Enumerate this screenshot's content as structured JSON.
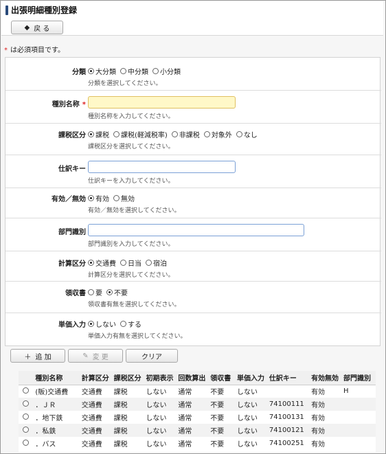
{
  "page": {
    "title": "出張明細種別登録",
    "back_label": "戻 る",
    "required_note": "は必須項目です。"
  },
  "form": {
    "category": {
      "label": "分類",
      "options": [
        "大分類",
        "中分類",
        "小分類"
      ],
      "selected": 0,
      "help": "分類を選択してください。"
    },
    "type_name": {
      "label": "種別名称",
      "value": "",
      "help": "種別名称を入力してください。"
    },
    "tax_category": {
      "label": "課税区分",
      "options": [
        "課税",
        "課税(軽減税率)",
        "非課税",
        "対象外",
        "なし"
      ],
      "selected": 0,
      "help": "課税区分を選択してください。"
    },
    "journal_key": {
      "label": "仕訳キー",
      "value": "",
      "help": "仕訳キーを入力してください。"
    },
    "enabled": {
      "label": "有効／無効",
      "options": [
        "有効",
        "無効"
      ],
      "selected": 0,
      "help": "有効／無効を選択してください。"
    },
    "dept_id": {
      "label": "部門識別",
      "value": "",
      "help": "部門識別を入力してください。"
    },
    "calc_category": {
      "label": "計算区分",
      "options": [
        "交通費",
        "日当",
        "宿泊"
      ],
      "selected": 0,
      "help": "計算区分を選択してください。"
    },
    "receipt": {
      "label": "領収書",
      "options": [
        "要",
        "不要"
      ],
      "selected": 1,
      "help": "領収書有無を選択してください。"
    },
    "unit_price": {
      "label": "単価入力",
      "options": [
        "しない",
        "する"
      ],
      "selected": 0,
      "help": "単価入力有無を選択してください。"
    }
  },
  "actions": {
    "add_label": "追 加",
    "edit_label": "変 更",
    "clear_label": "クリア"
  },
  "table": {
    "headers": [
      "種別名称",
      "計算区分",
      "課税区分",
      "初期表示",
      "回数算出",
      "領収書",
      "単価入力",
      "仕訳キー",
      "有効無効",
      "部門識別"
    ],
    "rows": [
      [
        "(販)交通費",
        "交通費",
        "課税",
        "しない",
        "通常",
        "不要",
        "しない",
        "",
        "有効",
        "H"
      ],
      [
        "．ＪＲ",
        "交通費",
        "課税",
        "しない",
        "通常",
        "不要",
        "しない",
        "74100111",
        "有効",
        ""
      ],
      [
        "．地下鉄",
        "交通費",
        "課税",
        "しない",
        "通常",
        "不要",
        "しない",
        "74100131",
        "有効",
        ""
      ],
      [
        "．私鉄",
        "交通費",
        "課税",
        "しない",
        "通常",
        "不要",
        "しない",
        "74100121",
        "有効",
        ""
      ],
      [
        "．バス",
        "交通費",
        "課税",
        "しない",
        "通常",
        "不要",
        "しない",
        "74100251",
        "有効",
        ""
      ]
    ]
  }
}
